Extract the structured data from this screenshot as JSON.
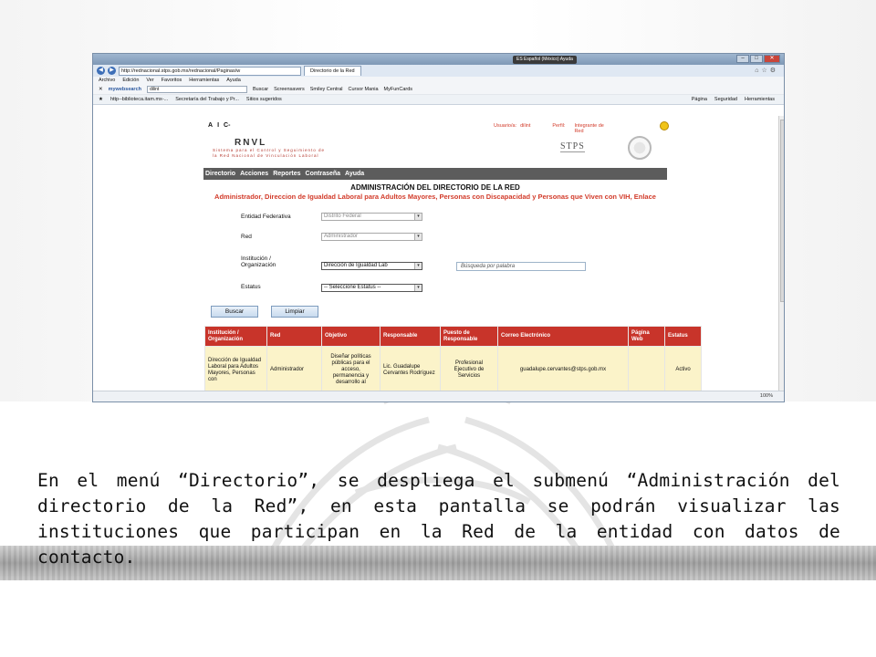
{
  "browser": {
    "language_indicator": "ES Español (México)  Ayuda",
    "url": "http://rednacional.stps.gob.mx/rednacional/Paginas/w",
    "tab_title": "Directorio de la Red",
    "menu": [
      "Archivo",
      "Edición",
      "Ver",
      "Favoritos",
      "Herramientas",
      "Ayuda"
    ],
    "toolbar": {
      "brand": "mywebsearch",
      "query": "dilint",
      "search_label": "Buscar",
      "items": [
        "Screensavers",
        "Smiley Central",
        "Cursor Mania",
        "MyFunCards"
      ]
    },
    "favorites": {
      "items": [
        "http--biblioteca.itam.mx-...",
        "Secretaría del Trabajo y Pr...",
        "Sitios sugeridos"
      ],
      "right": [
        "Página",
        "Seguridad",
        "Herramientas"
      ]
    },
    "zoom": "100%"
  },
  "page": {
    "font_controls": [
      "A",
      "I",
      "C-"
    ],
    "user_label": "Usuario/a:",
    "user_value": "dilint",
    "perfil_label": "Perfil:",
    "perfil_value": "Integrante de Red",
    "logo": {
      "name": "RNVL",
      "line1": "Sistema para el Control y Seguimiento de",
      "line2": "la Red Nacional de Vinculación Laboral"
    },
    "stps_logo": "STPS",
    "nav": [
      "Directorio",
      "Acciones",
      "Reportes",
      "Contraseña",
      "Ayuda"
    ],
    "title": "ADMINISTRACIÓN DEL DIRECTORIO DE LA RED",
    "subtitle": "Administrador, Direccion de Igualdad Laboral para Adultos Mayores, Personas con Discapacidad y Personas que Viven con VIH, Enlace",
    "form": {
      "entidad_label": "Entidad Federativa",
      "entidad_value": "Distrito Federal",
      "red_label": "Red",
      "red_value": "Administrador",
      "institucion_label": "Institución / Organización",
      "institucion_value": "Dirección de Igualdad Lab",
      "search_placeholder": "Búsqueda por palabra",
      "estatus_label": "Estatus",
      "estatus_value": "-- Seleccione Estatus --",
      "buscar": "Buscar",
      "limpiar": "Limpiar"
    },
    "table": {
      "headers": [
        "Institución / Organización",
        "Red",
        "Objetivo",
        "Responsable",
        "Puesto de Responsable",
        "Correo Electrónico",
        "Página Web",
        "Estatus"
      ],
      "row": [
        "Dirección de Igualdad Laboral para Adultos Mayores, Personas con",
        "Administrador",
        "Diseñar políticas públicas para el acceso, permanencia y desarrollo al",
        "Lic. Guadalupe Cervantes Rodríguez",
        "Profesional Ejecutivo de Servicios",
        "guadalupe.cervantes@stps.gob.mx",
        "",
        "Activo"
      ]
    }
  },
  "caption": "En el menú “Directorio”, se despliega el submenú “Administración del directorio de la Red”, en esta pantalla se podrán visualizar las instituciones que participan en la Red de la entidad con datos de contacto."
}
